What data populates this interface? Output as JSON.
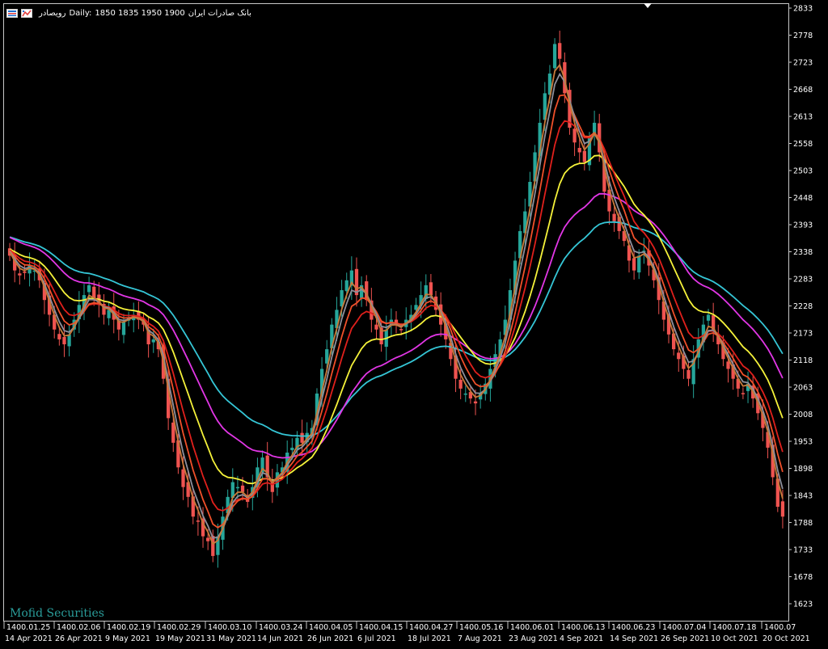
{
  "header": {
    "symbol": "رویصادر",
    "period": "Daily:",
    "levels": "1850 1835 1950 1900",
    "name": "بانک صادرات ایران"
  },
  "watermark": "Mofid Securities",
  "colors": {
    "background": "#000000",
    "bull_candle": "#26a69a",
    "bear_candle": "#ef5350",
    "ma_cyan": "#35c6d6",
    "ma_magenta": "#e236e6",
    "ma_yellow": "#f5f23a",
    "ma_red": "#e0201c",
    "ma_orange_red": "#f0502a",
    "ma_gray": "#8f8f9a",
    "ma_brown": "#c87a3a"
  },
  "chart_data": {
    "type": "candlestick",
    "title": "",
    "ylim": [
      1590,
      2850
    ],
    "y_ticks": [
      2833,
      2778,
      2723,
      2668,
      2613,
      2558,
      2503,
      2448,
      2393,
      2338,
      2283,
      2228,
      2173,
      2118,
      2063,
      2008,
      1953,
      1898,
      1843,
      1788,
      1733,
      1678,
      1623
    ],
    "x_labels_top": [
      "1400.01.25",
      "1400.02.06",
      "1400.02.19",
      "1400.02.29",
      "1400.03.10",
      "1400.03.24",
      "1400.04.05",
      "1400.04.15",
      "1400.04.27",
      "1400.05.16",
      "1400.06.01",
      "1400.06.13",
      "1400.06.23",
      "1400.07.04",
      "1400.07.18",
      "1400.07"
    ],
    "x_labels_bottom": [
      "14 Apr 2021",
      "26 Apr 2021",
      "9 May 2021",
      "19 May 2021",
      "31 May 2021",
      "14 Jun 2021",
      "26 Jun 2021",
      "6 Jul 2021",
      "18 Jul 2021",
      "7 Aug 2021",
      "23 Aug 2021",
      "4 Sep 2021",
      "14 Sep 2021",
      "26 Sep 2021",
      "10 Oct 2021",
      "20 Oct 2021"
    ],
    "closes": [
      2330,
      2300,
      2290,
      2295,
      2310,
      2300,
      2280,
      2240,
      2210,
      2180,
      2160,
      2150,
      2170,
      2200,
      2230,
      2250,
      2270,
      2240,
      2230,
      2210,
      2220,
      2200,
      2180,
      2195,
      2205,
      2210,
      2200,
      2190,
      2150,
      2160,
      2140,
      2080,
      2000,
      1950,
      1900,
      1860,
      1840,
      1800,
      1790,
      1760,
      1750,
      1720,
      1760,
      1800,
      1840,
      1870,
      1860,
      1850,
      1830,
      1860,
      1900,
      1920,
      1880,
      1850,
      1890,
      1900,
      1930,
      1940,
      1960,
      1950,
      1970,
      1980,
      2050,
      2100,
      2140,
      2190,
      2220,
      2260,
      2280,
      2300,
      2250,
      2270,
      2240,
      2200,
      2180,
      2150,
      2180,
      2200,
      2190,
      2180,
      2200,
      2210,
      2230,
      2250,
      2270,
      2250,
      2220,
      2190,
      2160,
      2120,
      2080,
      2060,
      2050,
      2040,
      2030,
      2050,
      2070,
      2100,
      2130,
      2160,
      2200,
      2260,
      2320,
      2380,
      2420,
      2480,
      2540,
      2600,
      2660,
      2700,
      2760,
      2730,
      2660,
      2590,
      2560,
      2540,
      2520,
      2570,
      2600,
      2540,
      2460,
      2420,
      2400,
      2380,
      2360,
      2320,
      2300,
      2330,
      2340,
      2310,
      2280,
      2240,
      2200,
      2170,
      2140,
      2120,
      2100,
      2080,
      2120,
      2160,
      2190,
      2210,
      2180,
      2150,
      2120,
      2100,
      2080,
      2060,
      2050,
      2070,
      2040,
      2010,
      1980,
      1940,
      1880,
      1820,
      1800
    ]
  }
}
